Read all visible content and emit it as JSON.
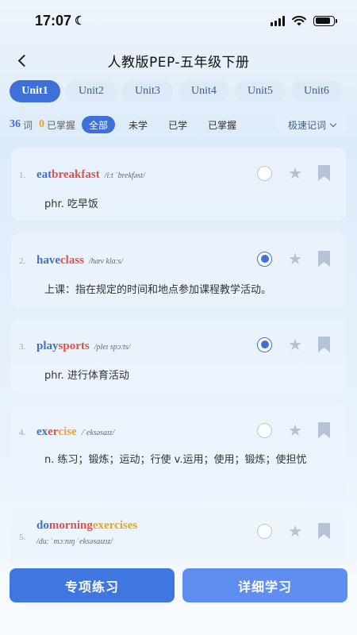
{
  "status": {
    "time": "17:07",
    "moon": "☾"
  },
  "nav": {
    "title": "人教版PEP-五年级下册"
  },
  "units": [
    "Unit1",
    "Unit2",
    "Unit3",
    "Unit4",
    "Unit5",
    "Unit6"
  ],
  "filter": {
    "total_count": "36",
    "total_label": "词",
    "mastered_count": "0",
    "mastered_label": "已掌握",
    "chips": [
      "全部",
      "未学",
      "已学",
      "已掌握"
    ],
    "speed_label": "极速记词"
  },
  "words": [
    {
      "index": "1.",
      "parts": [
        [
          "eat",
          "blue"
        ],
        [
          " breakfast",
          "red"
        ]
      ],
      "phonetic": "/iːt ˈbrekfəst/",
      "meaning": "phr. 吃早饭",
      "checked": false
    },
    {
      "index": "2.",
      "parts": [
        [
          "have",
          "blue"
        ],
        [
          " class",
          "red"
        ]
      ],
      "phonetic": "/hæv klɑːs/",
      "meaning": "上课：指在规定的时间和地点参加课程教学活动。",
      "checked": true
    },
    {
      "index": "3.",
      "parts": [
        [
          "play",
          "blue"
        ],
        [
          " sports",
          "red"
        ]
      ],
      "phonetic": "/pleɪ spɔːts/",
      "meaning": "phr. 进行体育活动",
      "checked": true
    },
    {
      "index": "4.",
      "parts": [
        [
          "ex",
          "blue"
        ],
        [
          "er",
          "red"
        ],
        [
          "cise",
          "orange"
        ]
      ],
      "phonetic": "/ˈeksəsaɪz/",
      "meaning": "n. 练习；锻炼；运动；行使 v.运用；使用；锻炼；使担忧",
      "checked": false
    },
    {
      "index": "5.",
      "parts": [
        [
          "do",
          "blue"
        ],
        [
          " morning",
          "red"
        ],
        [
          " exercises",
          "orange"
        ]
      ],
      "phonetic": "/duː ˈmɔːnɪŋ ˈeksəsaɪzɪz/",
      "meaning": "",
      "checked": false
    }
  ],
  "buttons": {
    "practice": "专项练习",
    "study": "详细学习"
  },
  "colors": {
    "accent": "#3d70d8",
    "red": "#e2504a",
    "orange": "#f0a21a"
  },
  "icons": [
    "back-icon",
    "radio-icon",
    "star-icon",
    "bookmark-icon",
    "chevron-down-icon",
    "wifi-icon",
    "signal-icon",
    "battery-icon"
  ]
}
